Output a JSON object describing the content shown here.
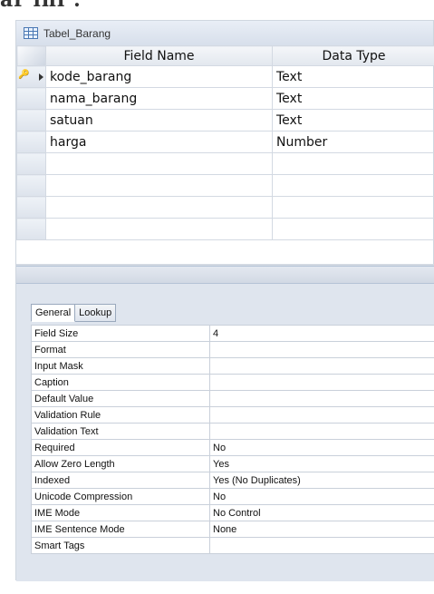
{
  "top_fragment": "ar ini :",
  "window": {
    "title": "Tabel_Barang",
    "icon": "table-icon"
  },
  "grid": {
    "headers": [
      "Field Name",
      "Data Type"
    ],
    "rows": [
      {
        "field": "kode_barang",
        "type": "Text",
        "primary_key": true
      },
      {
        "field": "nama_barang",
        "type": "Text",
        "primary_key": false
      },
      {
        "field": "satuan",
        "type": "Text",
        "primary_key": false
      },
      {
        "field": "harga",
        "type": "Number",
        "primary_key": false
      },
      {
        "field": "",
        "type": "",
        "primary_key": false
      },
      {
        "field": "",
        "type": "",
        "primary_key": false
      },
      {
        "field": "",
        "type": "",
        "primary_key": false
      },
      {
        "field": "",
        "type": "",
        "primary_key": false
      }
    ]
  },
  "properties": {
    "tabs": [
      "General",
      "Lookup"
    ],
    "active_tab": "General",
    "rows": [
      {
        "label": "Field Size",
        "value": "4"
      },
      {
        "label": "Format",
        "value": ""
      },
      {
        "label": "Input Mask",
        "value": ""
      },
      {
        "label": "Caption",
        "value": ""
      },
      {
        "label": "Default Value",
        "value": ""
      },
      {
        "label": "Validation Rule",
        "value": ""
      },
      {
        "label": "Validation Text",
        "value": ""
      },
      {
        "label": "Required",
        "value": "No"
      },
      {
        "label": "Allow Zero Length",
        "value": "Yes"
      },
      {
        "label": "Indexed",
        "value": "Yes (No Duplicates)"
      },
      {
        "label": "Unicode Compression",
        "value": "No"
      },
      {
        "label": "IME Mode",
        "value": "No Control"
      },
      {
        "label": "IME Sentence Mode",
        "value": "None"
      },
      {
        "label": "Smart Tags",
        "value": ""
      }
    ]
  }
}
